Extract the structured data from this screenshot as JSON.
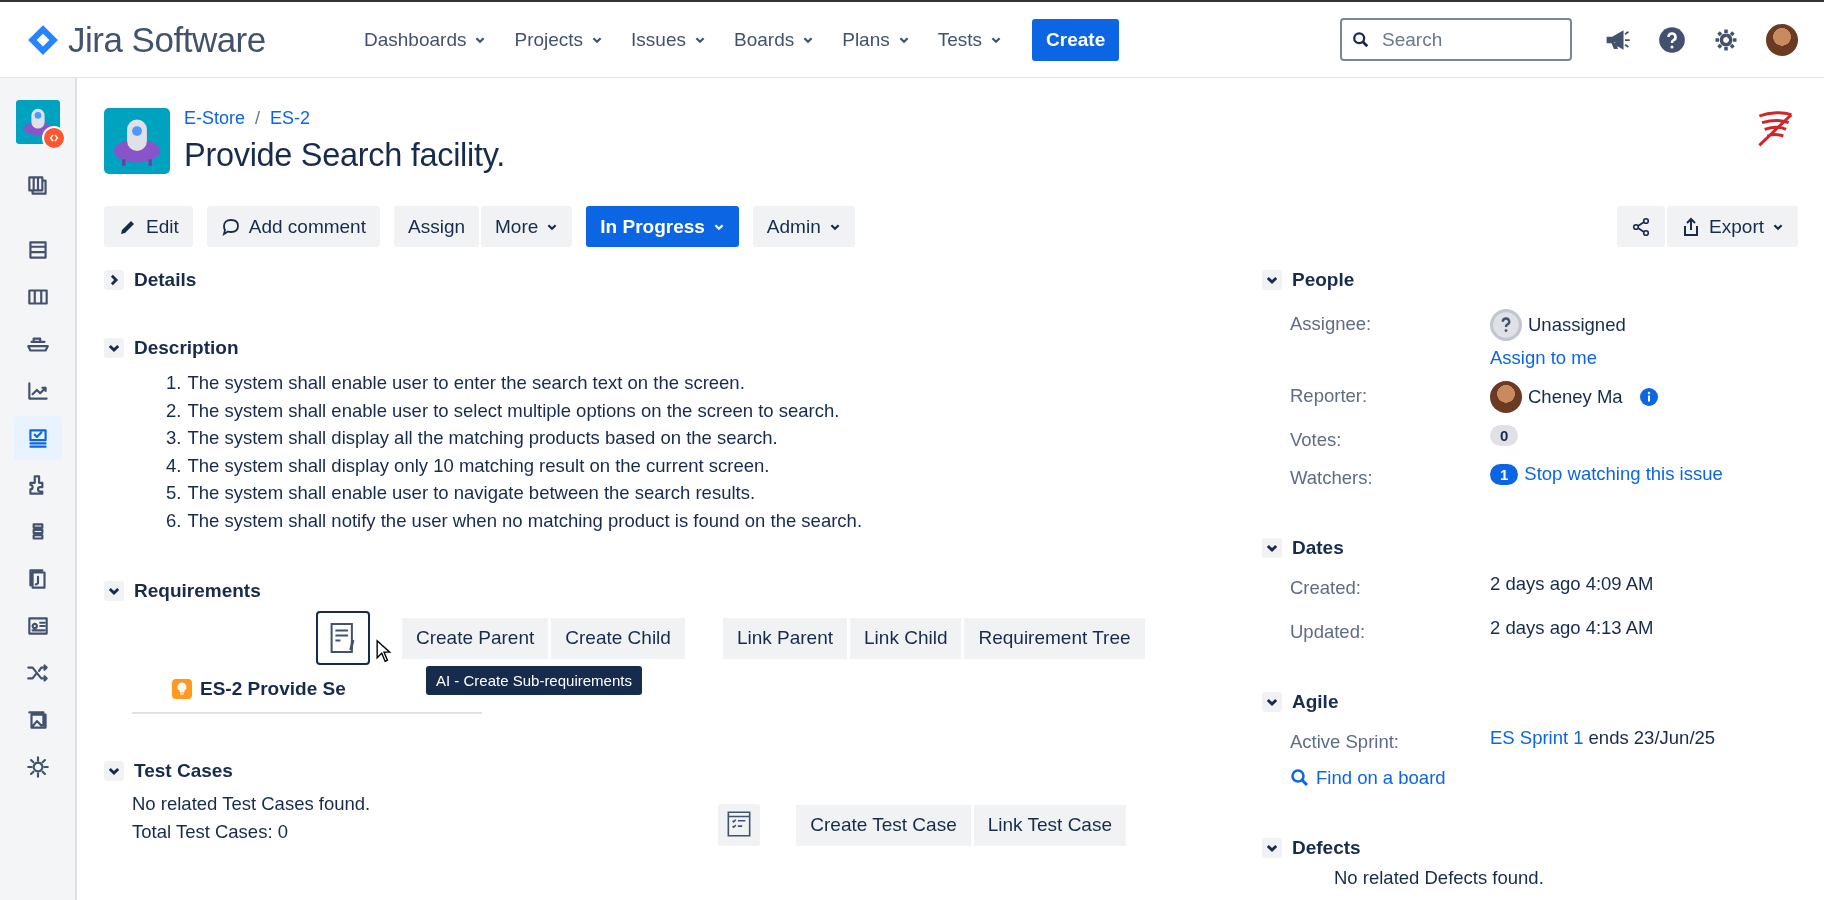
{
  "header": {
    "product": "Jira Software",
    "nav": [
      {
        "label": "Dashboards"
      },
      {
        "label": "Projects"
      },
      {
        "label": "Issues"
      },
      {
        "label": "Boards"
      },
      {
        "label": "Plans"
      },
      {
        "label": "Tests"
      }
    ],
    "create": "Create",
    "search": {
      "placeholder": "Search"
    }
  },
  "sidebar": [
    {
      "selected": false
    },
    {
      "selected": false
    },
    {
      "selected": false
    },
    {
      "selected": false
    },
    {
      "selected": false
    },
    {
      "selected": true
    },
    {
      "selected": false
    },
    {
      "selected": false
    },
    {
      "selected": false
    },
    {
      "selected": false
    },
    {
      "selected": false
    },
    {
      "selected": false
    },
    {
      "selected": false
    }
  ],
  "breadcrumbs": [
    "E-Store",
    "ES-2"
  ],
  "breadcrumb_separator": "/",
  "title": "Provide Search facility.",
  "toolbar": [
    [
      {
        "label": "Edit",
        "kind": "edit"
      }
    ],
    [
      {
        "label": "Add comment",
        "kind": "comment"
      }
    ],
    [
      {
        "label": "Assign",
        "kind": "plain"
      },
      {
        "label": "More",
        "kind": "menu"
      }
    ],
    [
      {
        "label": "In Progress",
        "kind": "primary"
      }
    ],
    [
      {
        "label": "Admin",
        "kind": "menu"
      }
    ]
  ],
  "toolbar_right": [
    {
      "kind": "share"
    },
    {
      "label": "Export",
      "kind": "export"
    }
  ],
  "details": {
    "title": "Details",
    "expanded": false
  },
  "description": {
    "title": "Description",
    "expanded": true,
    "items": [
      {
        "number": "1.",
        "text": "The system shall enable user to enter the search text on the screen."
      },
      {
        "number": "2.",
        "text": "The system shall enable user to select multiple options on the screen to search."
      },
      {
        "number": "3.",
        "text": "The system shall display all the matching products based on the search."
      },
      {
        "number": "4.",
        "text": "The system shall display only 10 matching result on the current screen."
      },
      {
        "number": "5.",
        "text": "The system shall enable user to navigate between the search results."
      },
      {
        "number": "6.",
        "text": "The system shall notify the user when no matching product is found on the search."
      }
    ]
  },
  "requirements": {
    "title": "Requirements",
    "expanded": true,
    "button_groups": [
      [
        "Create Parent",
        "Create Child"
      ],
      [
        "Link Parent",
        "Link Child",
        "Requirement Tree"
      ]
    ],
    "tooltip": "AI - Create Sub-requirements",
    "item": "ES-2 Provide Se"
  },
  "test_cases": {
    "title": "Test Cases",
    "expanded": true,
    "lines": [
      "No related Test Cases found.",
      "Total Test Cases: 0"
    ],
    "buttons": [
      "Create Test Case",
      "Link Test Case"
    ]
  },
  "people": {
    "title": "People",
    "expanded": true,
    "assignee": {
      "label": "Assignee:",
      "value": "Unassigned",
      "action": "Assign to me"
    },
    "reporter": {
      "label": "Reporter:",
      "value": "Cheney Ma"
    },
    "votes": {
      "label": "Votes:",
      "count": "0"
    },
    "watchers": {
      "label": "Watchers:",
      "count": "1",
      "action": "Stop watching this issue"
    }
  },
  "dates": {
    "title": "Dates",
    "expanded": true,
    "rows": [
      {
        "label": "Created:",
        "value": "2 days ago 4:09 AM"
      },
      {
        "label": "Updated:",
        "value": "2 days ago 4:13 AM"
      }
    ]
  },
  "agile": {
    "title": "Agile",
    "expanded": true,
    "label": "Active Sprint:",
    "sprint": "ES Sprint 1",
    "ends": "ends 23/Jun/25",
    "find": "Find on a board"
  },
  "defects": {
    "title": "Defects",
    "expanded": true,
    "text": "No related Defects found."
  }
}
